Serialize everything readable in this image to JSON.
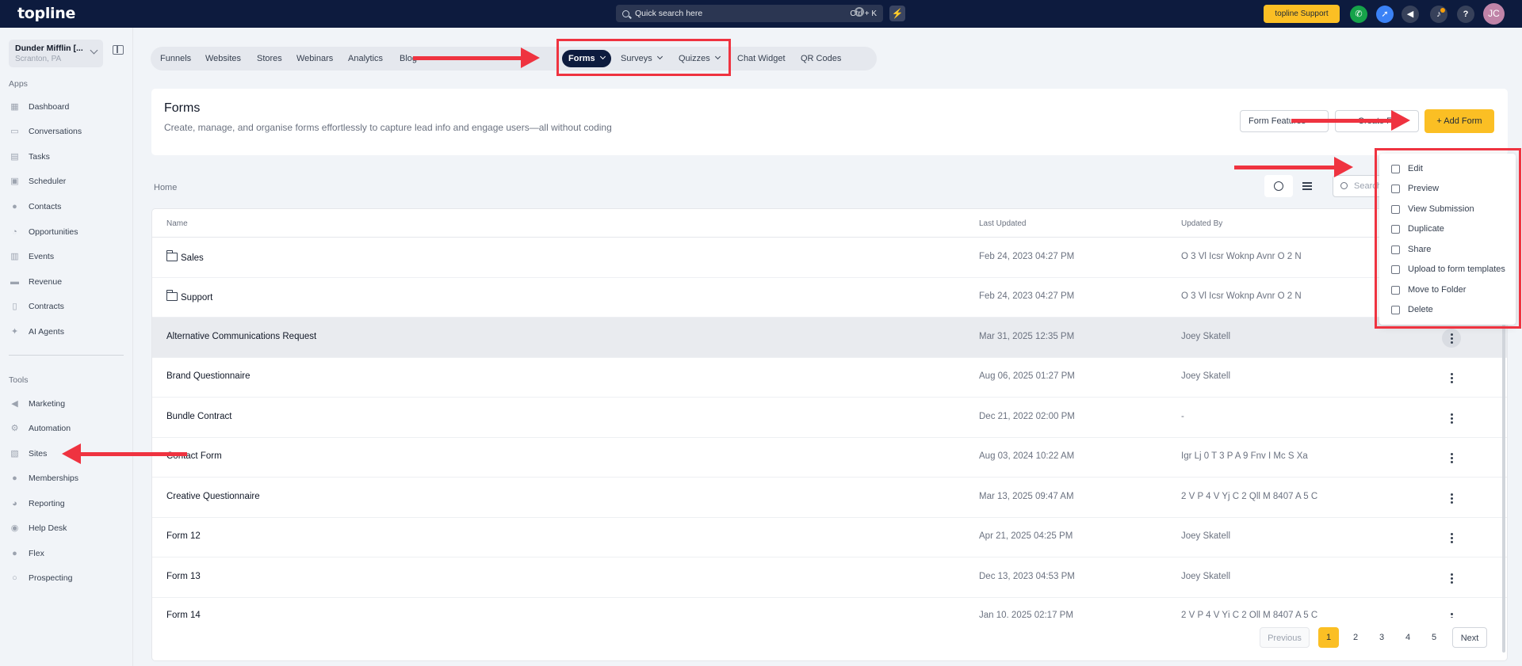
{
  "app": {
    "logo": "topline"
  },
  "topbar": {
    "search_placeholder": "Quick search here",
    "search_shortcut": "Ctrl + K",
    "support_label": "topline Support",
    "avatar_initials": "JC"
  },
  "account": {
    "name": "Dunder Mifflin [...",
    "location": "Scranton, PA"
  },
  "sidebar": {
    "apps_heading": "Apps",
    "apps": [
      {
        "label": "Dashboard",
        "icon": "dashboard-icon"
      },
      {
        "label": "Conversations",
        "icon": "chat-icon"
      },
      {
        "label": "Tasks",
        "icon": "tasks-icon"
      },
      {
        "label": "Scheduler",
        "icon": "calendar-icon"
      },
      {
        "label": "Contacts",
        "icon": "person-icon"
      },
      {
        "label": "Opportunities",
        "icon": "pie-icon"
      },
      {
        "label": "Events",
        "icon": "events-icon"
      },
      {
        "label": "Revenue",
        "icon": "card-icon"
      },
      {
        "label": "Contracts",
        "icon": "document-icon"
      },
      {
        "label": "AI Agents",
        "icon": "sparkle-icon"
      }
    ],
    "tools_heading": "Tools",
    "tools": [
      {
        "label": "Marketing",
        "icon": "megaphone-icon"
      },
      {
        "label": "Automation",
        "icon": "automation-icon"
      },
      {
        "label": "Sites",
        "icon": "sites-icon"
      },
      {
        "label": "Memberships",
        "icon": "members-icon"
      },
      {
        "label": "Reporting",
        "icon": "chart-icon"
      },
      {
        "label": "Help Desk",
        "icon": "help-icon"
      },
      {
        "label": "Flex",
        "icon": "flex-icon"
      },
      {
        "label": "Prospecting",
        "icon": "search-icon"
      }
    ]
  },
  "tabs": {
    "funnels": "Funnels",
    "websites": "Websites",
    "stores": "Stores",
    "webinars": "Webinars",
    "analytics": "Analytics",
    "blogs": "Blog",
    "forms": "Forms",
    "surveys": "Surveys",
    "quizzes": "Quizzes",
    "chat_widget": "Chat Widget",
    "qr_codes": "QR Codes"
  },
  "header": {
    "title": "Forms",
    "subtitle": "Create, manage, and organise forms effortlessly to capture lead info and engage users—all without coding",
    "btn_features": "Form Features",
    "btn_create": "Create Fo",
    "btn_add": "+  Add Form"
  },
  "breadcrumb": "Home",
  "search_placeholder": "Search",
  "table": {
    "col_name": "Name",
    "col_updated": "Last Updated",
    "col_by": "Updated By",
    "rows": [
      {
        "name": "Sales",
        "date": "Feb 24, 2023 04:27 PM",
        "by": "O 3 Vl Icsr Woknp Avnr O 2 N"
      },
      {
        "name": "Support",
        "date": "Feb 24, 2023 04:27 PM",
        "by": "O 3 Vl Icsr Woknp Avnr O 2 N"
      },
      {
        "name": "Alternative Communications Request",
        "date": "Mar 31, 2025 12:35 PM",
        "by": "Joey Skatell"
      },
      {
        "name": "Brand Questionnaire",
        "date": "Aug 06, 2025 01:27 PM",
        "by": "Joey Skatell"
      },
      {
        "name": "Bundle Contract",
        "date": "Dec 21, 2022 02:00 PM",
        "by": "-"
      },
      {
        "name": "Contact Form",
        "date": "Aug 03, 2024 10:22 AM",
        "by": "Igr Lj 0 T 3 P A 9 Fnv I Mc S Xa"
      },
      {
        "name": "Creative Questionnaire",
        "date": "Mar 13, 2025 09:47 AM",
        "by": "2 V P 4 V Yj C 2 Qll M 8407 A 5 C"
      },
      {
        "name": "Form 12",
        "date": "Apr 21, 2025 04:25 PM",
        "by": "Joey Skatell"
      },
      {
        "name": "Form 13",
        "date": "Dec 13, 2023 04:53 PM",
        "by": "Joey Skatell"
      },
      {
        "name": "Form 14",
        "date": "Jan 10, 2025 02:17 PM",
        "by": "2 V P 4 V Yj C 2 Qll M 8407 A 5 C"
      }
    ]
  },
  "pagination": {
    "prev": "Previous",
    "pages": [
      "1",
      "2",
      "3",
      "4",
      "5"
    ],
    "next": "Next",
    "current": "1"
  },
  "menu": {
    "items": [
      {
        "label": "Edit",
        "icon": "pencil-icon"
      },
      {
        "label": "Preview",
        "icon": "external-link-icon"
      },
      {
        "label": "View Submission",
        "icon": "document-icon"
      },
      {
        "label": "Duplicate",
        "icon": "copy-icon"
      },
      {
        "label": "Share",
        "icon": "share-icon"
      },
      {
        "label": "Upload to form templates",
        "icon": "upload-icon"
      },
      {
        "label": "Move to Folder",
        "icon": "move-icon"
      },
      {
        "label": "Delete",
        "icon": "trash-icon"
      }
    ]
  },
  "colors": {
    "accent": "#fbbf24",
    "nav": "#0d1b3e",
    "annotation": "#ef3340"
  }
}
